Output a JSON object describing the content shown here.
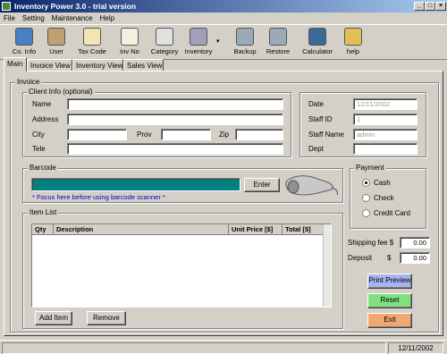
{
  "window": {
    "title": "Inventory Power 3.0 - trial version"
  },
  "menu": [
    "File",
    "Setting",
    "Maintenance",
    "Help"
  ],
  "toolbar": [
    {
      "label": "Co. Info",
      "icon": "company-icon"
    },
    {
      "label": "User",
      "icon": "user-icon"
    },
    {
      "label": "Tax Code",
      "icon": "tax-icon"
    },
    {
      "label": "Inv No",
      "icon": "invoice-number-icon"
    },
    {
      "label": "Category",
      "icon": "category-icon"
    },
    {
      "label": "Inventory",
      "icon": "inventory-icon"
    },
    {
      "label": "Backup",
      "icon": "backup-icon"
    },
    {
      "label": "Restore",
      "icon": "restore-icon"
    },
    {
      "label": "Calculator",
      "icon": "calculator-icon"
    },
    {
      "label": "help",
      "icon": "help-icon"
    }
  ],
  "tabs": [
    "Main",
    "Invoice View",
    "Inventory View",
    "Sales View"
  ],
  "invoice": {
    "group_label": "Invoice",
    "client": {
      "group_label": "Client Info (optional)",
      "name_label": "Name",
      "name_value": "",
      "address_label": "Address",
      "address_value": "",
      "city_label": "City",
      "city_value": "",
      "prov_label": "Prov",
      "prov_value": "",
      "zip_label": "Zip",
      "zip_value": "",
      "tele_label": "Tele",
      "tele_value": ""
    },
    "meta": {
      "date_label": "Date",
      "date_value": "12/11/2002",
      "staff_id_label": "Staff ID",
      "staff_id_value": "1",
      "staff_name_label": "Staff Name",
      "staff_name_value": "admin",
      "dept_label": "Dept",
      "dept_value": ""
    },
    "barcode": {
      "group_label": "Barcode",
      "enter_label": "Enter",
      "hint": "* Focus here before using barcode scanner *",
      "field_color": "#008080"
    },
    "payment": {
      "group_label": "Payment",
      "options": [
        "Cash",
        "Check",
        "Credit Card"
      ],
      "selected": "Cash"
    },
    "items": {
      "group_label": "Item List",
      "columns": [
        "Qty",
        "Description",
        "Unit Price [$]",
        "Total [$]"
      ],
      "rows": [],
      "add_label": "Add Item",
      "remove_label": "Remove"
    },
    "totals": {
      "shipping_label": "Shipping fee $",
      "shipping_value": "0.00",
      "deposit_label": "Deposit",
      "deposit_currency": "$",
      "deposit_value": "0.00"
    },
    "actions": {
      "print_label": "Print Preview",
      "print_color": "#a8b4f0",
      "reset_label": "Reset",
      "reset_color": "#7fe07f",
      "exit_label": "Exit",
      "exit_color": "#f0a870"
    }
  },
  "status": {
    "date": "12/11/2002"
  }
}
